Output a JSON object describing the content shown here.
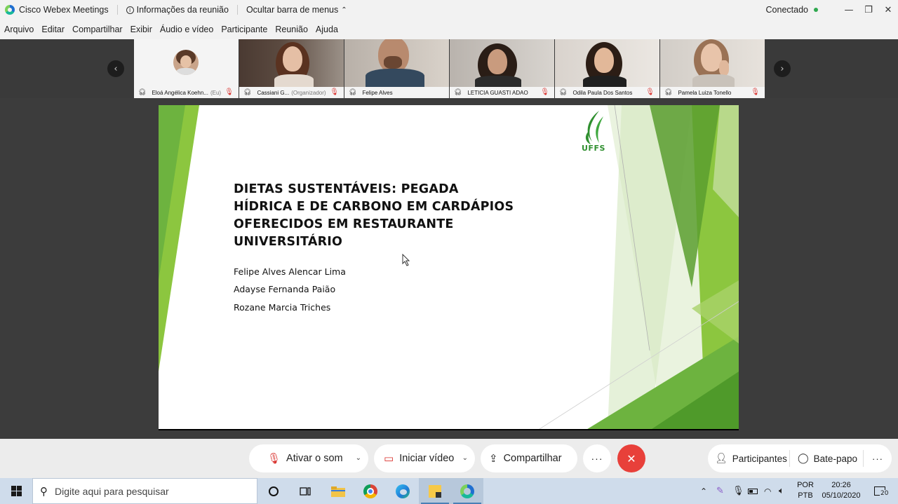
{
  "titlebar": {
    "app_name": "Cisco Webex Meetings",
    "meeting_info": "Informações da reunião",
    "hide_menu": "Ocultar barra de menus",
    "status": "Conectado"
  },
  "menu": [
    "Arquivo",
    "Editar",
    "Compartilhar",
    "Exibir",
    "Áudio e vídeo",
    "Participante",
    "Reunião",
    "Ajuda"
  ],
  "participants": [
    {
      "name": "Eloá Angélica Koehn...",
      "role": "(Eu)"
    },
    {
      "name": "Cassiani G...",
      "role": "(Organizador)"
    },
    {
      "name": "Felipe Alves",
      "role": ""
    },
    {
      "name": "LETICIA GUASTI ADAO",
      "role": ""
    },
    {
      "name": "Odila Paula Dos Santos",
      "role": ""
    },
    {
      "name": "Pamela Luiza Tonello",
      "role": ""
    }
  ],
  "slide": {
    "title_lines": [
      "DIETAS SUSTENTÁVEIS: PEGADA",
      "HÍDRICA E DE CARBONO EM CARDÁPIOS",
      "OFERECIDOS EM RESTAURANTE",
      "UNIVERSITÁRIO"
    ],
    "authors": [
      "Felipe Alves Alencar Lima",
      "Adayse Fernanda Paião",
      "Rozane Marcia Triches"
    ],
    "logo_text": "UFFS"
  },
  "controls": {
    "unmute": "Ativar o som",
    "start_video": "Iniciar vídeo",
    "share": "Compartilhar",
    "more": "···",
    "participants": "Participantes",
    "chat": "Bate-papo"
  },
  "taskbar": {
    "search_placeholder": "Digite aqui para pesquisar",
    "lang_top": "POR",
    "lang_bottom": "PTB",
    "time": "20:26",
    "date": "05/10/2020",
    "notifications": "20"
  },
  "colors": {
    "slide_green": "#6db33f",
    "end_call": "#e8403a",
    "active_speaker": "#1aa3e8",
    "mute_red": "#d9302c"
  }
}
